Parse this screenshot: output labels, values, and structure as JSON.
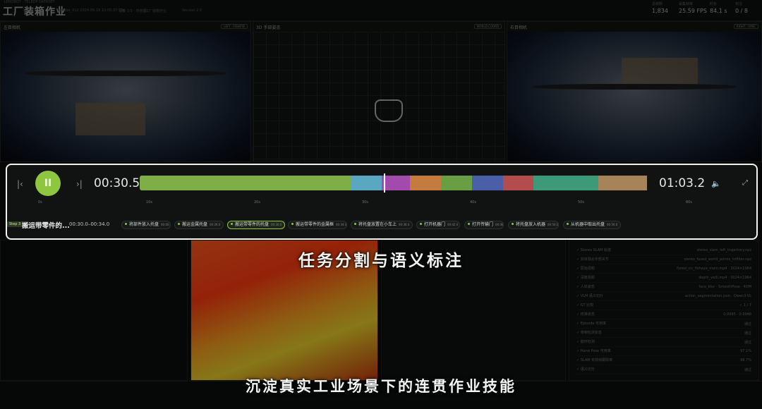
{
  "app": {
    "title": "工厂装箱作业",
    "subtitle": "LEROBOT · TELEOP DATASET",
    "meta": [
      "Episode_012  2024-06-18  10:05:37  72s",
      "视角 1/3 · 传感器",
      "工厂装箱作业",
      "Version 2.0"
    ],
    "stats": [
      {
        "key": "总帧数",
        "value": "1,834"
      },
      {
        "key": "采集帧率",
        "value": "25.59 FPS"
      },
      {
        "key": "时长",
        "value": "84.1 s"
      },
      {
        "key": "标注",
        "value": "0 / 8"
      }
    ]
  },
  "panels": {
    "left": {
      "title": "左目相机",
      "tag": "LEFT · FISHEYE"
    },
    "center": {
      "title": "3D 手部姿态",
      "tag": "WORLD COORD"
    },
    "right": {
      "title": "右目相机",
      "tag": "RIGHT · SYNC"
    }
  },
  "timeline": {
    "prev_icon": "|‹",
    "play_icon": "II",
    "next_icon": "›|",
    "current_time": "00:30.5",
    "total_time": "01:03.2",
    "playhead": 0.474,
    "volume_icon": "speaker-icon",
    "fullscreen_icon": "⤢",
    "ticks": [
      "0s",
      "10s",
      "20s",
      "30s",
      "40s",
      "50s",
      "60s"
    ],
    "segments": [
      {
        "color": "#7fae47",
        "length": 0.41
      },
      {
        "color": "#59a7c1",
        "length": 0.06
      },
      {
        "color": "#a24bad",
        "length": 0.055
      },
      {
        "color": "#c57b3e",
        "length": 0.06
      },
      {
        "color": "#6a9e43",
        "length": 0.06
      },
      {
        "color": "#4b5fa9",
        "length": 0.06
      },
      {
        "color": "#b34c4c",
        "length": 0.06
      },
      {
        "color": "#3c9a78",
        "length": 0.125
      },
      {
        "color": "#a7835a",
        "length": 0.095
      }
    ],
    "step_badge": "Step 3",
    "current_label": "搬运带零件的...",
    "current_range": "00:30.0–00:34.0",
    "chips": [
      {
        "label": "将部件放入托盘",
        "time": "00:00.0"
      },
      {
        "label": "搬运金属托盘",
        "time": "00:26.0"
      },
      {
        "label": "搬运带零件的托盘",
        "time": "00:30.0",
        "active": true
      },
      {
        "label": "搬运带零件的金属框",
        "time": "00:34.0"
      },
      {
        "label": "将托盘放置在小车上",
        "time": "00:38.0"
      },
      {
        "label": "打开机器门",
        "time": "00:42.0"
      },
      {
        "label": "打开传输门",
        "time": "00:46.0"
      },
      {
        "label": "将托盘放入机器",
        "time": "00:50.0"
      },
      {
        "label": "从机器中取出托盘",
        "time": "00:56.0"
      }
    ]
  },
  "side_list": [
    {
      "k": "Stereo SLAM 轨迹",
      "v": "stereo_slam_left_trajectory.npz"
    },
    {
      "k": "双目融合手部关节",
      "v": "stereo_fused_world_points_trifilter.npz"
    },
    {
      "k": "原始视频",
      "v": "fused_cic_fisheye_main.mp4 · 3024×1964"
    },
    {
      "k": "深度视频",
      "v": "depth_vedi.mp4 · 3024×1964"
    },
    {
      "k": "人体姿态",
      "v": "face_blur · SmoothPose · 4DM"
    },
    {
      "k": "VLM 语义切分",
      "v": "action_segmentation.json · Qwen3-VL"
    },
    {
      "k": "GT 比较",
      "v": "✓ 1 / 7"
    },
    {
      "k": "校准状态",
      "v": "0.0995 · 0.9948"
    },
    {
      "k": "Episode 可用率",
      "v": "通过"
    },
    {
      "k": "骨架检测状态",
      "v": "通过"
    },
    {
      "k": "胶环检测",
      "v": "通过"
    },
    {
      "k": "Hand Pose 可用率",
      "v": "97.1%"
    },
    {
      "k": "SLAM 有效帧跟踪率",
      "v": "98.7%"
    },
    {
      "k": "语义切分",
      "v": "通过"
    }
  ],
  "captions": {
    "top": "任务分割与语义标注",
    "bottom": "沉淀真实工业场景下的连贯作业技能"
  }
}
